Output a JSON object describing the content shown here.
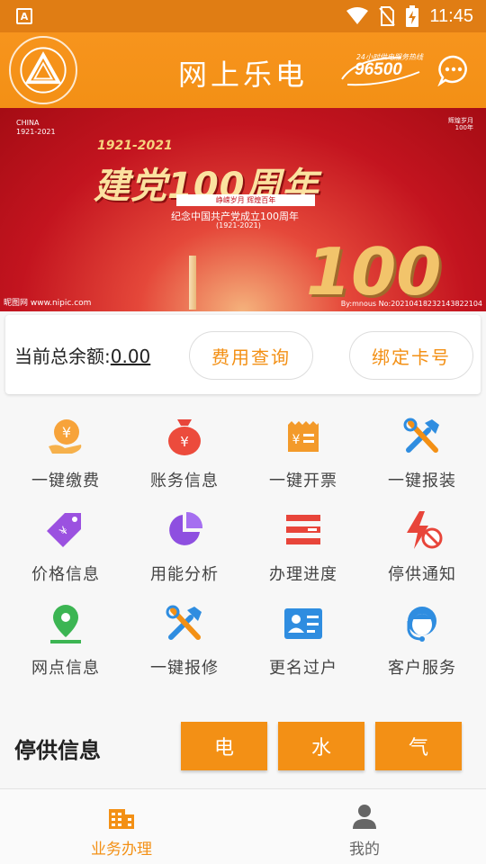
{
  "status_bar": {
    "time": "11:45"
  },
  "header": {
    "title": "网上乐电",
    "hotline_caption": "24小时供电服务热线",
    "hotline_number": "96500"
  },
  "banner": {
    "country": "CHINA",
    "country_years": "1921-2021",
    "years": "1921-2021",
    "headline": "建党100周年",
    "tagline": "峥嵘岁月 辉煌百年",
    "subtitle": "纪念中国共产党成立100周年",
    "subtitle_years": "(1921-2021)",
    "big_number": "100",
    "corner_text": "辉煌岁月\n100年",
    "watermark_left": "昵图网 www.nipic.com",
    "watermark_right": "By:mnous No:20210418232143822104"
  },
  "balance": {
    "label": "当前总余额:",
    "value": "0.00",
    "fee_query": "费用查询",
    "bind_card": "绑定卡号"
  },
  "services": [
    {
      "label": "一键缴费",
      "icon": "payment-hand-icon"
    },
    {
      "label": "账务信息",
      "icon": "money-bag-icon"
    },
    {
      "label": "一键开票",
      "icon": "invoice-icon"
    },
    {
      "label": "一键报装",
      "icon": "tools-icon"
    },
    {
      "label": "价格信息",
      "icon": "price-tag-icon"
    },
    {
      "label": "用能分析",
      "icon": "pie-chart-icon"
    },
    {
      "label": "办理进度",
      "icon": "progress-list-icon"
    },
    {
      "label": "停供通知",
      "icon": "power-off-icon"
    },
    {
      "label": "网点信息",
      "icon": "location-pin-icon"
    },
    {
      "label": "一键报修",
      "icon": "repair-tools-icon"
    },
    {
      "label": "更名过户",
      "icon": "id-card-icon"
    },
    {
      "label": "客户服务",
      "icon": "customer-service-icon"
    }
  ],
  "outage": {
    "label": "停供信息",
    "electric": "电",
    "water": "水",
    "gas": "气"
  },
  "tabbar": {
    "business": "业务办理",
    "mine": "我的"
  },
  "colors": {
    "primary": "#f39015",
    "banner_red": "#c3141f"
  }
}
